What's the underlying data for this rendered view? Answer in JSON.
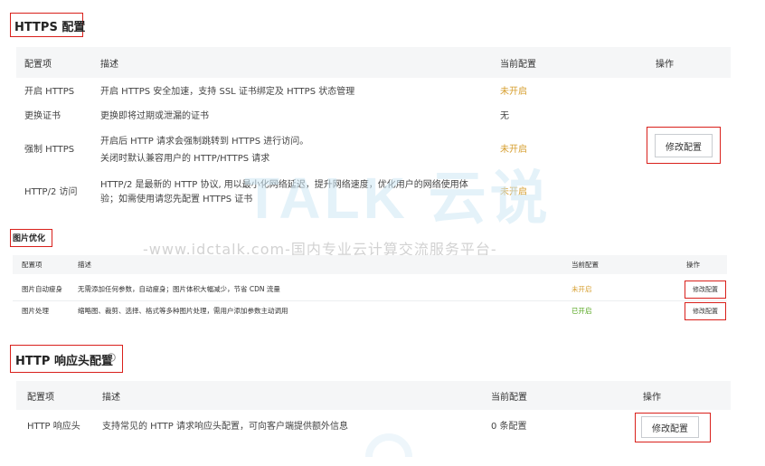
{
  "https": {
    "title": "HTTPS 配置",
    "headers": [
      "配置项",
      "描述",
      "当前配置",
      "操作"
    ],
    "rows": [
      {
        "name": "开启 HTTPS",
        "desc": [
          "开启 HTTPS 安全加速，支持 SSL 证书绑定及 HTTPS 状态管理"
        ],
        "status": "未开启"
      },
      {
        "name": "更换证书",
        "desc": [
          "更换即将过期或泄漏的证书"
        ],
        "status": "无"
      },
      {
        "name": "强制 HTTPS",
        "desc": [
          "开启后 HTTP 请求会强制跳转到 HTTPS 进行访问。",
          "关闭时默认兼容用户的 HTTP/HTTPS 请求"
        ],
        "status": "未开启"
      },
      {
        "name": "HTTP/2 访问",
        "desc": [
          "HTTP/2 是最新的 HTTP 协议, 用以最小化网络延迟，提升网络速度，优化用户的网络使用体",
          "验；如需使用请您先配置 HTTPS 证书"
        ],
        "status": "未开启"
      }
    ],
    "modify_label": "修改配置"
  },
  "image": {
    "title": "图片优化",
    "headers": [
      "配置项",
      "描述",
      "当前配置",
      "操作"
    ],
    "rows": [
      {
        "name": "图片自动瘦身",
        "desc": "无需添加任何参数，自动瘦身；图片体积大幅减少，节省 CDN 流量",
        "status": "未开启",
        "action": "修改配置"
      },
      {
        "name": "图片处理",
        "desc": "缩略图、裁剪、选择、格式等多种图片处理，需用户添加参数主动调用",
        "status": "已开启",
        "action": "修改配置"
      }
    ]
  },
  "header_cfg": {
    "title": "HTTP 响应头配置",
    "info_icon": "info-circle-icon",
    "headers": [
      "配置项",
      "描述",
      "当前配置",
      "操作"
    ],
    "rows": [
      {
        "name": "HTTP 响应头",
        "desc": "支持常见的 HTTP 请求响应头配置，可向客户端提供额外信息",
        "status": "0 条配置",
        "action": "修改配置"
      }
    ]
  },
  "watermark": {
    "logo": "TALK 云说",
    "url": "-www.idctalk.com-国内专业云计算交流服务平台-"
  },
  "colors": {
    "accent_red": "#d9201b",
    "status_off": "#d69e2e",
    "status_on": "#52a41a"
  }
}
